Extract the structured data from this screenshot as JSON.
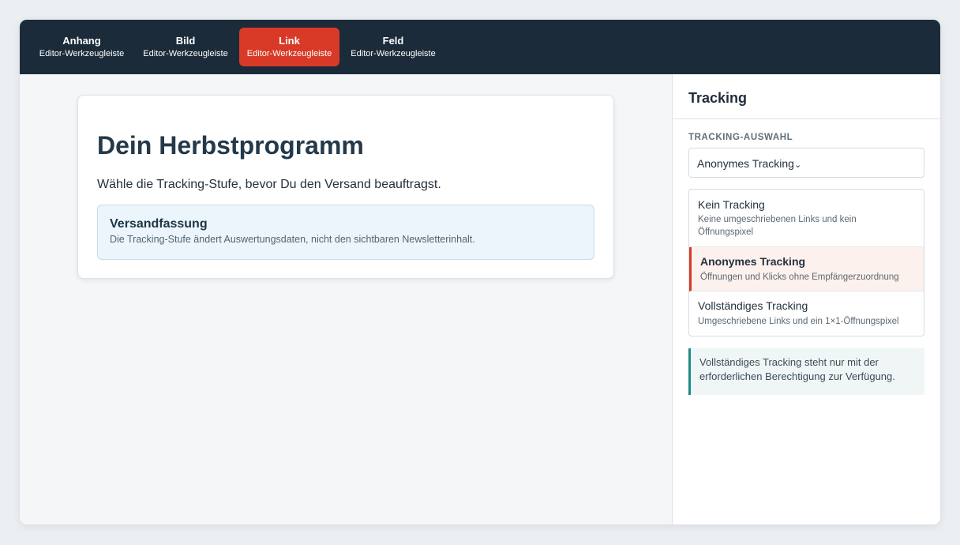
{
  "toolbar": {
    "tabs": [
      {
        "label": "Anhang",
        "sublabel": "Editor-Werkzeugleiste",
        "active": false
      },
      {
        "label": "Bild",
        "sublabel": "Editor-Werkzeugleiste",
        "active": false
      },
      {
        "label": "Link",
        "sublabel": "Editor-Werkzeugleiste",
        "active": true
      },
      {
        "label": "Feld",
        "sublabel": "Editor-Werkzeugleiste",
        "active": false
      }
    ]
  },
  "main": {
    "heading": "Dein Herbstprogramm",
    "intro": "Wähle die Tracking-Stufe, bevor Du den Versand beauftragst.",
    "summary": {
      "title": "Versandfassung",
      "text": "Die Tracking-Stufe ändert Auswertungsdaten, nicht den sichtbaren Newsletterinhalt."
    }
  },
  "sidebar": {
    "title": "Tracking",
    "field_label": "TRACKING-AUSWAHL",
    "select_value": "Anonymes Tracking",
    "chevron": "⌄",
    "options": [
      {
        "label": "Kein Tracking",
        "description": "Keine umgeschriebenen Links und kein Öffnungspixel",
        "selected": false
      },
      {
        "label": "Anonymes Tracking",
        "description": "Öffnungen und Klicks ohne Empfängerzuordnung",
        "selected": true
      },
      {
        "label": "Vollständiges Tracking",
        "description": "Umgeschriebene Links und ein 1×1-Öffnungspixel",
        "selected": false
      }
    ],
    "notice": "Vollständiges Tracking steht nur mit der erforderlichen Berechtigung zur Verfügung."
  },
  "colors": {
    "toolbar_bg": "#1b2b3a",
    "accent": "#d83a27",
    "notice_border": "#1b8c84",
    "summary_bg": "#ebf5fb"
  },
  "icons": {
    "select_chevron": "chevron-down-icon"
  }
}
